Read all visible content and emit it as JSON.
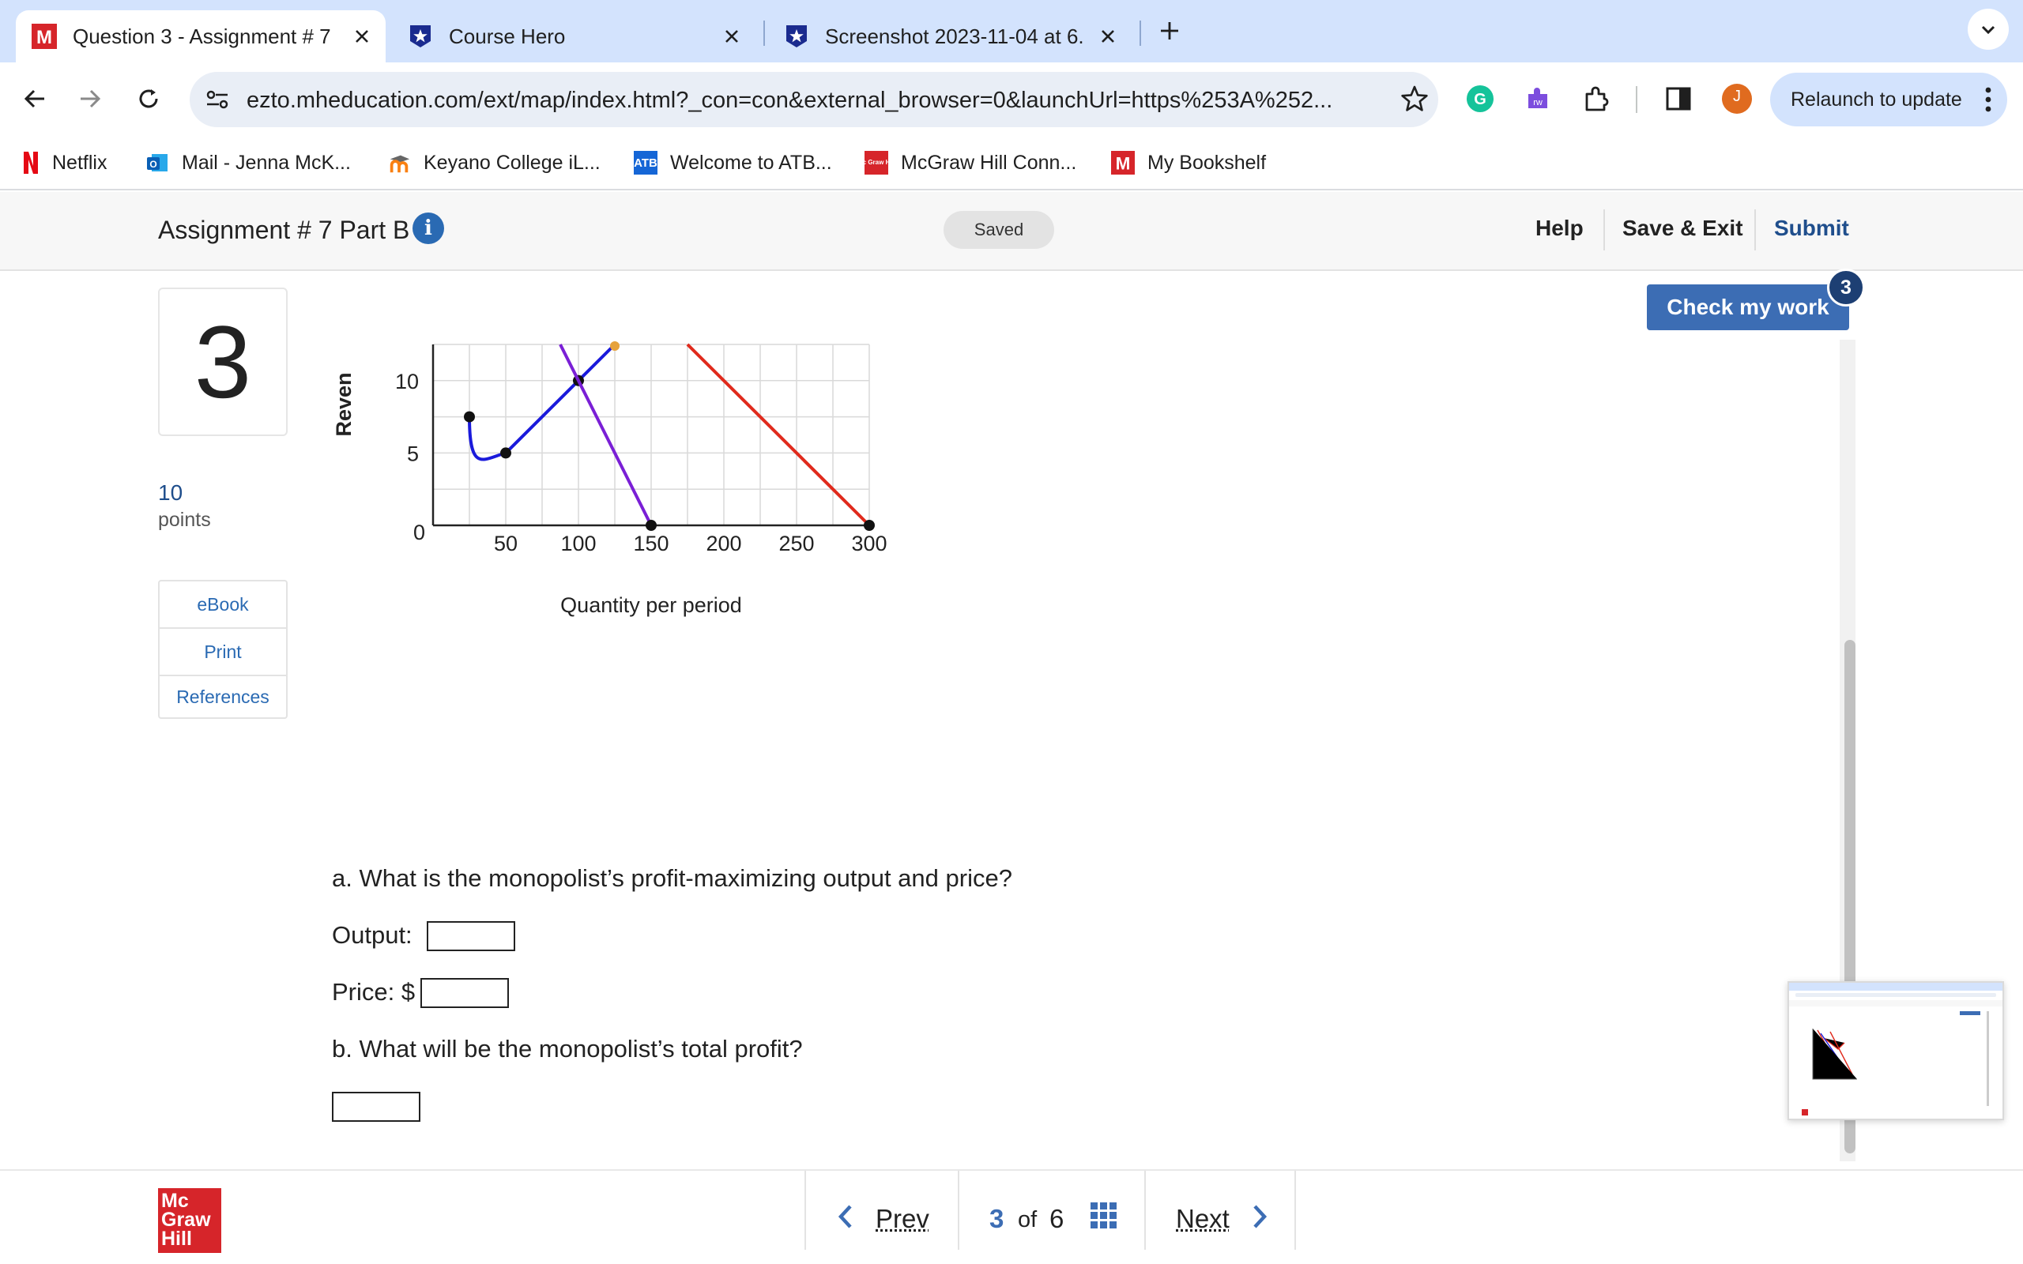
{
  "browser": {
    "tabs": [
      {
        "title": "Question 3 - Assignment # 7",
        "icon": "mcgraw-hill-m-icon",
        "active": true
      },
      {
        "title": "Course Hero",
        "icon": "course-hero-star-icon",
        "active": false
      },
      {
        "title": "Screenshot 2023-11-04 at 6.",
        "icon": "course-hero-star-icon",
        "active": false
      }
    ],
    "url": "ezto.mheducation.com/ext/map/index.html?_con=con&external_browser=0&launchUrl=https%253A%252...",
    "profile_initial": "J",
    "relaunch_label": "Relaunch to update",
    "bookmarks": [
      {
        "label": "Netflix",
        "icon": "netflix-icon"
      },
      {
        "label": "Mail - Jenna McK...",
        "icon": "outlook-icon"
      },
      {
        "label": "Keyano College iL...",
        "icon": "moodle-icon"
      },
      {
        "label": "Welcome to ATB...",
        "icon": "atb-icon"
      },
      {
        "label": "McGraw Hill Conn...",
        "icon": "mcgraw-hill-icon"
      },
      {
        "label": "My Bookshelf",
        "icon": "mcgraw-hill-m-icon"
      }
    ]
  },
  "header": {
    "assignment_title": "Assignment # 7 Part B",
    "saved_label": "Saved",
    "help_label": "Help",
    "save_exit_label": "Save & Exit",
    "submit_label": "Submit"
  },
  "question": {
    "number": "3",
    "points_value": "10",
    "points_label": "points",
    "side_links": [
      "eBook",
      "Print",
      "References"
    ],
    "check_label": "Check my work",
    "check_badge": "3",
    "part_a": "a. What is the monopolist’s profit-maximizing output and price?",
    "output_label": "Output:",
    "price_label": "Price: $",
    "part_b": "b. What will be the monopolist’s total profit?",
    "output_value": "",
    "price_value": "",
    "profit_value": ""
  },
  "chart_data": {
    "type": "line",
    "xlabel": "Quantity per period",
    "ylabel": "Reven",
    "x_ticks": [
      "50",
      "100",
      "150",
      "200",
      "250",
      "300"
    ],
    "y_ticks": [
      "0",
      "5",
      "10"
    ],
    "xlim": [
      0,
      300
    ],
    "ylim": [
      0,
      12.5
    ],
    "grid": true,
    "series": [
      {
        "color": "#1a1adb",
        "points": [
          [
            25,
            7.5
          ],
          [
            50,
            5
          ],
          [
            100,
            10
          ],
          [
            125,
            12.5
          ]
        ],
        "markers": [
          [
            25,
            7.5
          ],
          [
            50,
            5
          ],
          [
            100,
            10
          ]
        ]
      },
      {
        "color": "#7a1fd6",
        "points": [
          [
            87.5,
            12.5
          ],
          [
            150,
            0
          ]
        ],
        "markers": [
          [
            150,
            0
          ]
        ]
      },
      {
        "color": "#e02a1c",
        "points": [
          [
            175,
            12.5
          ],
          [
            300,
            0
          ]
        ],
        "markers": [
          [
            300,
            0
          ]
        ]
      }
    ],
    "accent_marker": {
      "color": "#e6a23c",
      "point": [
        125,
        12.5
      ]
    }
  },
  "footer": {
    "logo_lines": [
      "Mc",
      "Graw",
      "Hill"
    ],
    "prev_label": "Prev",
    "current_page": "3",
    "of_label": "of",
    "total_pages": "6",
    "next_label": "Next"
  },
  "colors": {
    "accent_blue": "#3c6db4",
    "link_blue": "#2a6ab3",
    "brand_red": "#d6252a",
    "tabstrip_bg": "#d3e3fd"
  }
}
